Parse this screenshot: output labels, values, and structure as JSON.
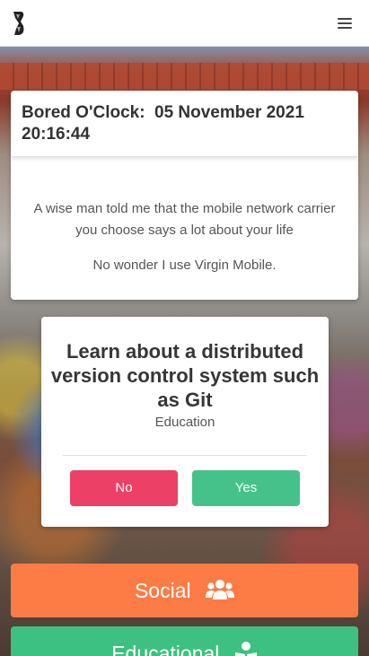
{
  "header": {
    "logo_icon": "bored-logo-icon",
    "menu_icon": "hamburger-menu-icon"
  },
  "time_card": {
    "label": "Bored O'Clock:",
    "datetime": "05 November 2021 20:16:44",
    "quote_line": "A wise man told me that the mobile network carrier you choose says a lot about your life",
    "punchline": "No wonder I use Virgin Mobile."
  },
  "activity": {
    "title": "Learn about a distributed version control system such as Git",
    "category": "Education",
    "no_label": "No",
    "yes_label": "Yes",
    "no_color": "#ec4066",
    "yes_color": "#45c28a"
  },
  "categories": [
    {
      "label": "Social",
      "icon": "users-icon",
      "color": "#fd7b45"
    },
    {
      "label": "Educational",
      "icon": "reading-person-icon",
      "color": "#3dc182"
    }
  ]
}
